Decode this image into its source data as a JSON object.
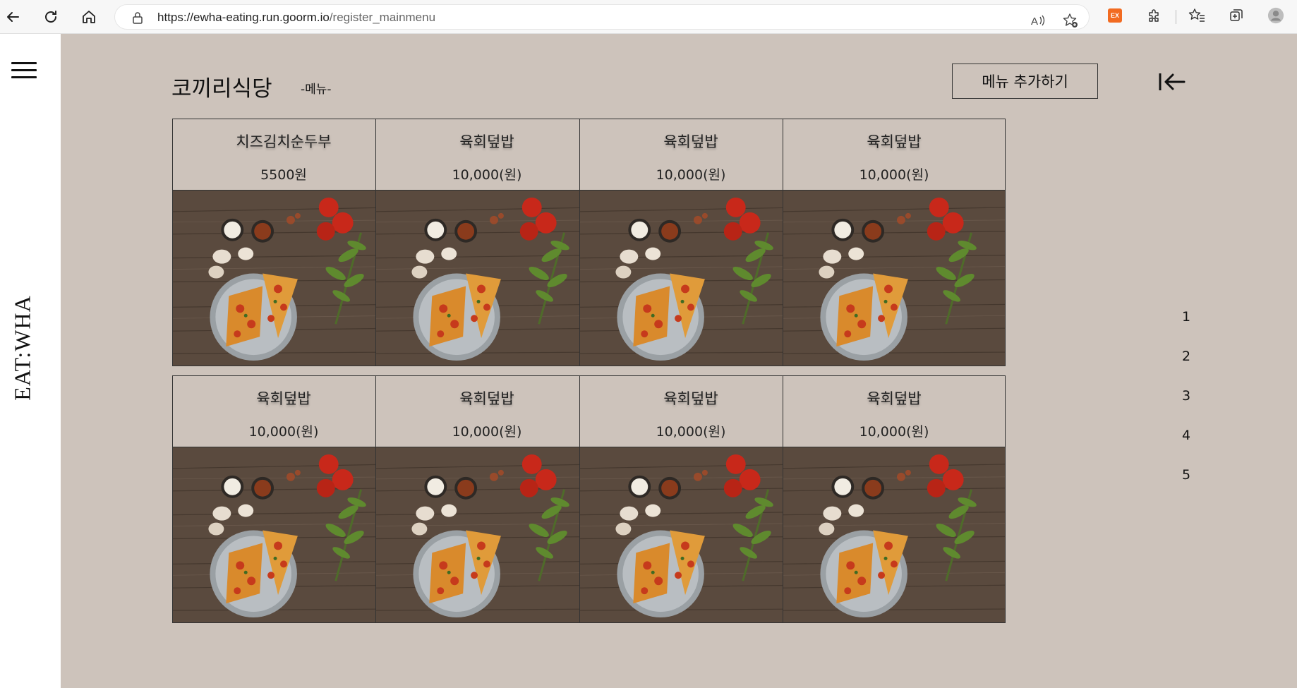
{
  "browser": {
    "url_host": "https://ewha-eating.run.goorm.io",
    "url_path": "/register_mainmenu",
    "ext_label": "EX"
  },
  "sidebar": {
    "logo": "EAT:WHA"
  },
  "header": {
    "title": "코끼리식당",
    "subtitle": "-메뉴-",
    "add_button": "메뉴 추가하기"
  },
  "menu_items": [
    {
      "name": "치즈김치순두부",
      "price": "5500원"
    },
    {
      "name": "육회덮밥",
      "price": "10,000(원)"
    },
    {
      "name": "육회덮밥",
      "price": "10,000(원)"
    },
    {
      "name": "육회덮밥",
      "price": "10,000(원)"
    },
    {
      "name": "육회덮밥",
      "price": "10,000(원)"
    },
    {
      "name": "육회덮밥",
      "price": "10,000(원)"
    },
    {
      "name": "육회덮밥",
      "price": "10,000(원)"
    },
    {
      "name": "육회덮밥",
      "price": "10,000(원)"
    }
  ],
  "pagination": [
    "1",
    "2",
    "3",
    "4",
    "5"
  ],
  "colors": {
    "main_bg": "#cdc3bb",
    "wood": "#5a4a3e",
    "ext_orange": "#f26b21"
  }
}
